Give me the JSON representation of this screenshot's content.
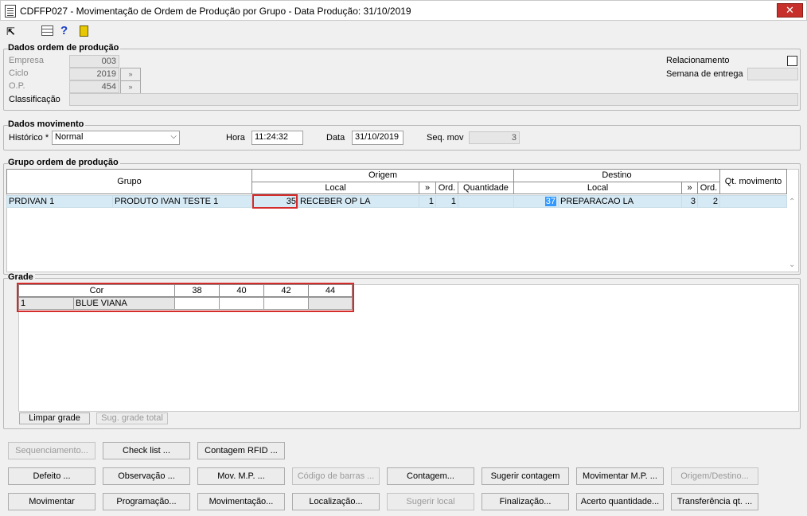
{
  "window": {
    "title": "CDFFP027 - Movimentação de Ordem de Produção por Grupo - Data Produção: 31/10/2019",
    "close_glyph": "✕"
  },
  "toolbar": {
    "icons": [
      "exit-arrow-icon",
      "grid-table-icon",
      "help-icon",
      "door-exit-icon"
    ]
  },
  "dados_ordem": {
    "label": "Dados ordem de produção",
    "empresa_label": "Empresa",
    "empresa_value": "003",
    "ciclo_label": "Ciclo",
    "ciclo_value": "2019",
    "op_label": "O.P.",
    "op_value": "454",
    "classificacao_label": "Classificação",
    "classificacao_value": "",
    "relacionamento_label": "Relacionamento",
    "semana_label": "Semana de entrega",
    "semana_value": ""
  },
  "dados_movimento": {
    "label": "Dados movimento",
    "historico_label": "Histórico *",
    "historico_value": "Normal",
    "hora_label": "Hora",
    "hora_value": "11:24:32",
    "data_label": "Data",
    "data_value": "31/10/2019",
    "seqmov_label": "Seq. mov",
    "seqmov_value": "3"
  },
  "grupo_ordem": {
    "label": "Grupo ordem de produção",
    "headers": {
      "grupo": "Grupo",
      "origem": "Origem",
      "destino": "Destino",
      "qt_movimento": "Qt. movimento",
      "local": "Local",
      "arrows": "»",
      "ord": "Ord.",
      "quantidade": "Quantidade"
    },
    "row": {
      "grupo_code": "PRDIVAN 1",
      "grupo_name": "PRODUTO IVAN TESTE 1",
      "origem_code": "35",
      "origem_local": "RECEBER OP LA",
      "origem_arrows": "1",
      "origem_ord": "1",
      "origem_qtd": "",
      "destino_code": "37",
      "destino_local": "PREPARACAO LA",
      "destino_arrows": "3",
      "destino_ord": "2",
      "qt_movimento": ""
    }
  },
  "grade": {
    "label": "Grade",
    "headers": [
      "Cor",
      "38",
      "40",
      "42",
      "44"
    ],
    "row": {
      "code": "1",
      "name": "BLUE VIANA"
    },
    "limpar_label": "Limpar grade",
    "sugerir_label": "Sug. grade total"
  },
  "buttons": {
    "row1": [
      "Sequenciamento...",
      "Check list ...",
      "Contagem RFID ..."
    ],
    "row2": [
      "Defeito ...",
      "Observação ...",
      "Mov. M.P. ...",
      "Código de barras ...",
      "Contagem...",
      "Sugerir contagem",
      "Movimentar M.P. ...",
      "Origem/Destino..."
    ],
    "row3": [
      "Movimentar",
      "Programação...",
      "Movimentação...",
      "Localização...",
      "Sugerir local",
      "Finalização...",
      "Acerto quantidade...",
      "Transferência qt. ..."
    ]
  }
}
